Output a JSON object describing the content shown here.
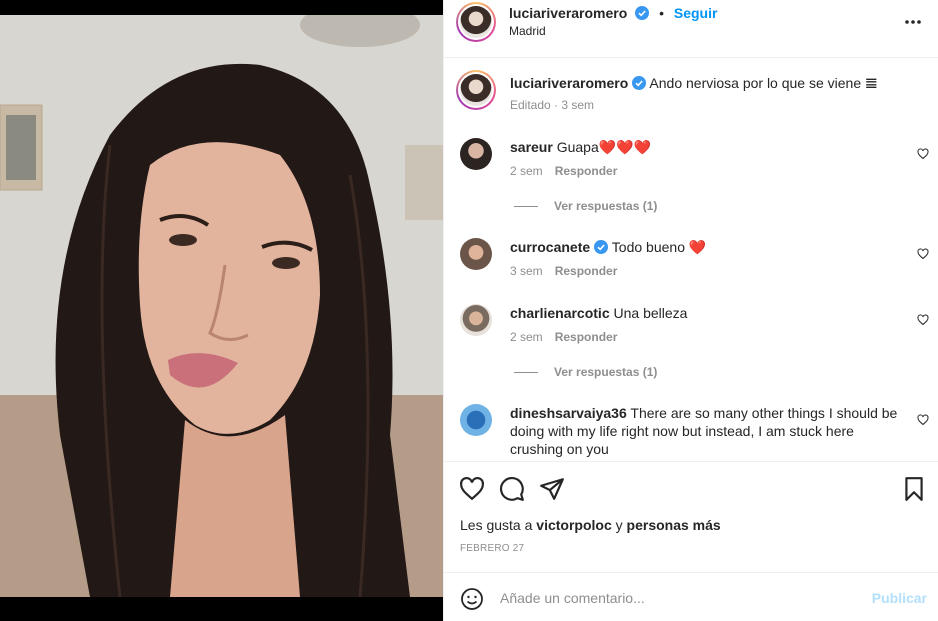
{
  "post": {
    "username": "luciariveraromero",
    "location": "Madrid",
    "follow_label": "Seguir",
    "dot": "•"
  },
  "caption": {
    "username": "luciariveraromero",
    "text": "Ando nerviosa por lo que se viene 𝌆",
    "meta": "Editado · 3 sem"
  },
  "comments": [
    {
      "username": "sareur",
      "verified": false,
      "text": "Guapa❤️❤️❤️",
      "time": "2 sem",
      "reply": "Responder",
      "replies": "Ver respuestas (1)"
    },
    {
      "username": "currocanete",
      "verified": true,
      "text": "Todo bueno ❤️",
      "time": "3 sem",
      "reply": "Responder",
      "replies": ""
    },
    {
      "username": "charlienarcotic",
      "verified": false,
      "text": "Una belleza",
      "time": "2 sem",
      "reply": "Responder",
      "replies": "Ver respuestas (1)"
    },
    {
      "username": "dineshsarvaiya36",
      "verified": false,
      "text": "There are so many other things I should be doing with my life right now but instead, I am stuck here crushing on you",
      "time": "",
      "reply": "",
      "replies": ""
    }
  ],
  "likes": {
    "prefix": "Les gusta a ",
    "user": "victorpoloc",
    "connector": " y ",
    "rest": "personas más"
  },
  "date": "FEBRERO 27",
  "add_comment": {
    "placeholder": "Añade un comentario...",
    "publish": "Publicar"
  },
  "icons": [
    "more-icon",
    "heart-icon",
    "comment-icon",
    "share-icon",
    "bookmark-icon",
    "emoji-icon",
    "verified-icon"
  ],
  "colors": {
    "accent": "#0095f6",
    "verified": "#3897f0",
    "publish_disabled": "#b2dffc",
    "muted": "#8e8e8e"
  }
}
